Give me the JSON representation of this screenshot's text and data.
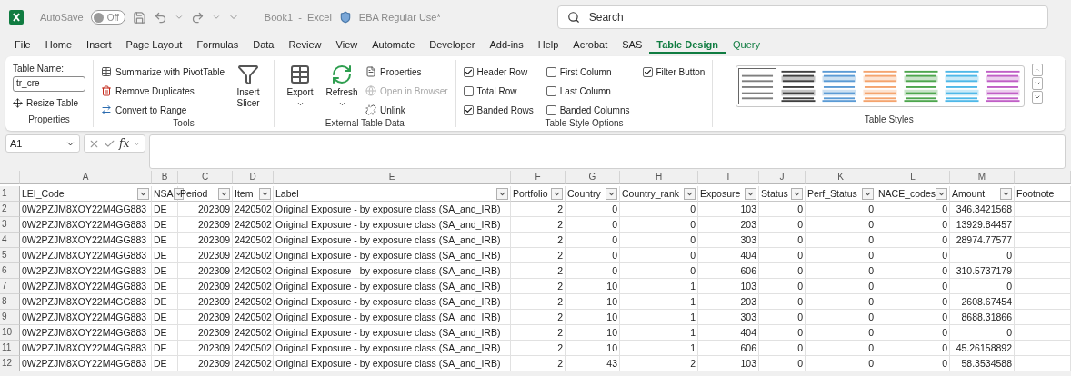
{
  "title_bar": {
    "autosave": {
      "label": "AutoSave",
      "on": false,
      "state_label": "Off"
    },
    "document_title": "Book1  -  Excel",
    "sensitivity": "EBA Regular Use*",
    "search": {
      "placeholder": "Search"
    }
  },
  "menu_tabs": [
    {
      "label": "File",
      "selected": false,
      "contextual": false
    },
    {
      "label": "Home",
      "selected": false,
      "contextual": false
    },
    {
      "label": "Insert",
      "selected": false,
      "contextual": false
    },
    {
      "label": "Page Layout",
      "selected": false,
      "contextual": false
    },
    {
      "label": "Formulas",
      "selected": false,
      "contextual": false
    },
    {
      "label": "Data",
      "selected": false,
      "contextual": false
    },
    {
      "label": "Review",
      "selected": false,
      "contextual": false
    },
    {
      "label": "View",
      "selected": false,
      "contextual": false
    },
    {
      "label": "Automate",
      "selected": false,
      "contextual": false
    },
    {
      "label": "Developer",
      "selected": false,
      "contextual": false
    },
    {
      "label": "Add-ins",
      "selected": false,
      "contextual": false
    },
    {
      "label": "Help",
      "selected": false,
      "contextual": false
    },
    {
      "label": "Acrobat",
      "selected": false,
      "contextual": false
    },
    {
      "label": "SAS",
      "selected": false,
      "contextual": false
    },
    {
      "label": "Table Design",
      "selected": true,
      "contextual": true
    },
    {
      "label": "Query",
      "selected": false,
      "contextual": true
    }
  ],
  "properties_group": {
    "name_label": "Table Name:",
    "table_name": "tr_cre",
    "resize_button": "Resize Table",
    "caption": "Properties"
  },
  "tools_group": {
    "buttons": [
      {
        "label": "Summarize with PivotTable"
      },
      {
        "label": "Remove Duplicates"
      },
      {
        "label": "Convert to Range"
      }
    ],
    "insert_slicer": "Insert Slicer",
    "caption": "Tools"
  },
  "external_group": {
    "export": "Export",
    "refresh": "Refresh",
    "small_buttons": [
      {
        "label": "Properties",
        "disabled": false
      },
      {
        "label": "Open in Browser",
        "disabled": true
      },
      {
        "label": "Unlink",
        "disabled": false
      }
    ],
    "caption": "External Table Data"
  },
  "style_options_group": {
    "options": [
      {
        "label": "Header Row",
        "checked": true
      },
      {
        "label": "Total Row",
        "checked": false
      },
      {
        "label": "Banded Rows",
        "checked": true
      },
      {
        "label": "First Column",
        "checked": false
      },
      {
        "label": "Last Column",
        "checked": false
      },
      {
        "label": "Banded Columns",
        "checked": false
      },
      {
        "label": "Filter Button",
        "checked": true
      }
    ],
    "caption": "Table Style Options"
  },
  "table_styles_group": {
    "styles": [
      {
        "color": "#7f7f7f",
        "selected": true
      },
      {
        "color": "#404040",
        "selected": false
      },
      {
        "color": "#5b9bd5",
        "selected": false
      },
      {
        "color": "#f4a46e",
        "selected": false
      },
      {
        "color": "#4ea64e",
        "selected": false
      },
      {
        "color": "#4fb8e8",
        "selected": false
      },
      {
        "color": "#c05fc6",
        "selected": false
      }
    ],
    "caption": "Table Styles"
  },
  "formula_bar": {
    "name_box": "A1",
    "function_label": "fx"
  },
  "sheet": {
    "column_letters": [
      "A",
      "B",
      "C",
      "D",
      "E",
      "F",
      "G",
      "H",
      "I",
      "J",
      "K",
      "L",
      "M"
    ],
    "header_row_number": "1",
    "headers": [
      {
        "label": "LEI_Code",
        "filter": true
      },
      {
        "label": "NSA",
        "filter": true
      },
      {
        "label": "Period",
        "filter": true
      },
      {
        "label": "Item",
        "filter": true
      },
      {
        "label": "Label",
        "filter": true
      },
      {
        "label": "Portfolio",
        "filter": true
      },
      {
        "label": "Country",
        "filter": true
      },
      {
        "label": "Country_rank",
        "filter": true
      },
      {
        "label": "Exposure",
        "filter": true
      },
      {
        "label": "Status",
        "filter": true
      },
      {
        "label": "Perf_Status",
        "filter": true
      },
      {
        "label": "NACE_codes",
        "filter": true
      },
      {
        "label": "Amount",
        "filter": true
      },
      {
        "label": "Footnote",
        "filter": false
      }
    ],
    "rows": [
      {
        "number": "2",
        "cells": [
          "0W2PZJM8XOY22M4GG883",
          "DE",
          "202309",
          "2420502",
          "Original Exposure - by exposure class (SA_and_IRB)",
          "2",
          "0",
          "0",
          "103",
          "0",
          "0",
          "0",
          "346.3421568"
        ]
      },
      {
        "number": "3",
        "cells": [
          "0W2PZJM8XOY22M4GG883",
          "DE",
          "202309",
          "2420502",
          "Original Exposure - by exposure class (SA_and_IRB)",
          "2",
          "0",
          "0",
          "203",
          "0",
          "0",
          "0",
          "13929.84457"
        ]
      },
      {
        "number": "4",
        "cells": [
          "0W2PZJM8XOY22M4GG883",
          "DE",
          "202309",
          "2420502",
          "Original Exposure - by exposure class (SA_and_IRB)",
          "2",
          "0",
          "0",
          "303",
          "0",
          "0",
          "0",
          "28974.77577"
        ]
      },
      {
        "number": "5",
        "cells": [
          "0W2PZJM8XOY22M4GG883",
          "DE",
          "202309",
          "2420502",
          "Original Exposure - by exposure class (SA_and_IRB)",
          "2",
          "0",
          "0",
          "404",
          "0",
          "0",
          "0",
          "0"
        ]
      },
      {
        "number": "6",
        "cells": [
          "0W2PZJM8XOY22M4GG883",
          "DE",
          "202309",
          "2420502",
          "Original Exposure - by exposure class (SA_and_IRB)",
          "2",
          "0",
          "0",
          "606",
          "0",
          "0",
          "0",
          "310.5737179"
        ]
      },
      {
        "number": "7",
        "cells": [
          "0W2PZJM8XOY22M4GG883",
          "DE",
          "202309",
          "2420502",
          "Original Exposure - by exposure class (SA_and_IRB)",
          "2",
          "10",
          "1",
          "103",
          "0",
          "0",
          "0",
          "0"
        ]
      },
      {
        "number": "8",
        "cells": [
          "0W2PZJM8XOY22M4GG883",
          "DE",
          "202309",
          "2420502",
          "Original Exposure - by exposure class (SA_and_IRB)",
          "2",
          "10",
          "1",
          "203",
          "0",
          "0",
          "0",
          "2608.67454"
        ]
      },
      {
        "number": "9",
        "cells": [
          "0W2PZJM8XOY22M4GG883",
          "DE",
          "202309",
          "2420502",
          "Original Exposure - by exposure class (SA_and_IRB)",
          "2",
          "10",
          "1",
          "303",
          "0",
          "0",
          "0",
          "8688.31866"
        ]
      },
      {
        "number": "10",
        "cells": [
          "0W2PZJM8XOY22M4GG883",
          "DE",
          "202309",
          "2420502",
          "Original Exposure - by exposure class (SA_and_IRB)",
          "2",
          "10",
          "1",
          "404",
          "0",
          "0",
          "0",
          "0"
        ]
      },
      {
        "number": "11",
        "cells": [
          "0W2PZJM8XOY22M4GG883",
          "DE",
          "202309",
          "2420502",
          "Original Exposure - by exposure class (SA_and_IRB)",
          "2",
          "10",
          "1",
          "606",
          "0",
          "0",
          "0",
          "45.26158892"
        ]
      },
      {
        "number": "12",
        "cells": [
          "0W2PZJM8XOY22M4GG883",
          "DE",
          "202309",
          "2420502",
          "Original Exposure - by exposure class (SA_and_IRB)",
          "2",
          "43",
          "2",
          "103",
          "0",
          "0",
          "0",
          "58.3534588"
        ]
      }
    ]
  }
}
